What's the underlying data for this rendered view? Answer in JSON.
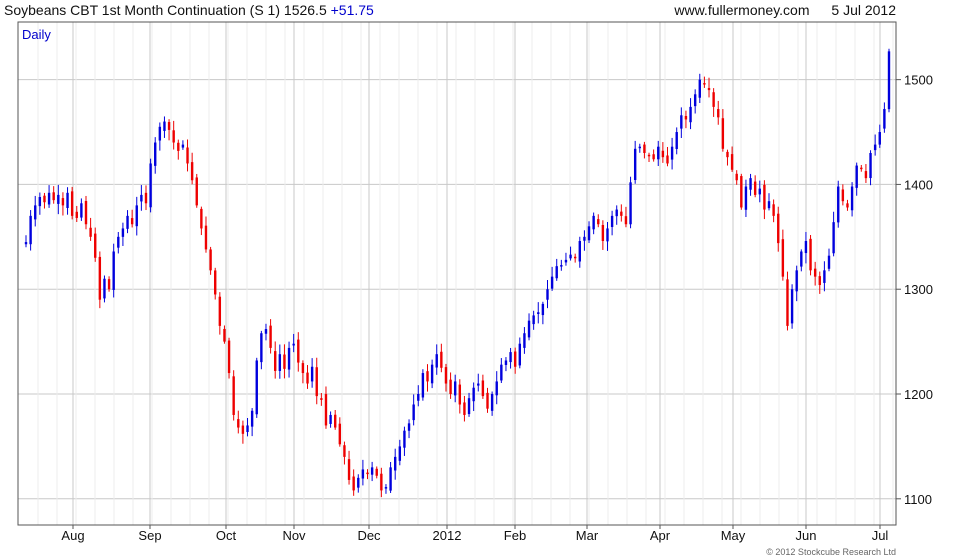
{
  "header": {
    "symbol": "Soybeans CBT 1st Month Continuation (S 1)",
    "last": "1526.5",
    "change": "+51.75",
    "site": "www.fullermoney.com",
    "date": "5 Jul 2012"
  },
  "period_label": "Daily",
  "copyright": "© 2012 Stockcube Research Ltd",
  "colors": {
    "up": "#0000dd",
    "down": "#ee0000",
    "grid": "#c8c8c8",
    "frame": "#555555",
    "accent": "#0000cc"
  },
  "chart_data": {
    "type": "ohlc",
    "title": "Soybeans CBT 1st Month Continuation (S 1)",
    "xlabel": "",
    "ylabel": "",
    "ylim": [
      1075,
      1555
    ],
    "y_ticks": [
      1100,
      1200,
      1300,
      1400,
      1500
    ],
    "x_ticks": [
      "Aug",
      "Sep",
      "Oct",
      "Nov",
      "Dec",
      "2012",
      "Feb",
      "Mar",
      "Apr",
      "May",
      "Jun",
      "Jul"
    ],
    "grid": true,
    "y_axis_side": "right",
    "closes": [
      1345,
      1370,
      1380,
      1388,
      1383,
      1392,
      1385,
      1390,
      1380,
      1392,
      1370,
      1368,
      1382,
      1362,
      1350,
      1330,
      1290,
      1310,
      1300,
      1336,
      1350,
      1358,
      1370,
      1362,
      1380,
      1390,
      1382,
      1420,
      1440,
      1455,
      1460,
      1452,
      1440,
      1432,
      1438,
      1420,
      1404,
      1380,
      1358,
      1338,
      1318,
      1295,
      1265,
      1250,
      1220,
      1180,
      1168,
      1162,
      1170,
      1184,
      1232,
      1258,
      1262,
      1244,
      1222,
      1238,
      1224,
      1244,
      1248,
      1230,
      1220,
      1210,
      1226,
      1198,
      1196,
      1170,
      1180,
      1168,
      1152,
      1140,
      1118,
      1108,
      1120,
      1128,
      1125,
      1130,
      1122,
      1108,
      1110,
      1130,
      1140,
      1150,
      1165,
      1172,
      1190,
      1200,
      1220,
      1212,
      1228,
      1238,
      1225,
      1210,
      1200,
      1212,
      1190,
      1180,
      1196,
      1206,
      1210,
      1198,
      1186,
      1200,
      1212,
      1228,
      1232,
      1240,
      1226,
      1248,
      1258,
      1270,
      1275,
      1278,
      1286,
      1300,
      1312,
      1322,
      1322,
      1328,
      1333,
      1330,
      1346,
      1350,
      1360,
      1370,
      1362,
      1346,
      1358,
      1370,
      1376,
      1370,
      1362,
      1402,
      1434,
      1436,
      1430,
      1427,
      1424,
      1436,
      1426,
      1420,
      1436,
      1450,
      1466,
      1462,
      1474,
      1486,
      1500,
      1496,
      1490,
      1474,
      1464,
      1434,
      1426,
      1414,
      1404,
      1378,
      1398,
      1406,
      1390,
      1396,
      1376,
      1384,
      1370,
      1344,
      1312,
      1265,
      1300,
      1318,
      1336,
      1346,
      1318,
      1312,
      1304,
      1318,
      1332,
      1364,
      1398,
      1384,
      1378,
      1398,
      1418,
      1416,
      1406,
      1430,
      1438,
      1450,
      1472,
      1527
    ],
    "ohlc_note": "open/high/low/low derived from closes by the render script"
  }
}
